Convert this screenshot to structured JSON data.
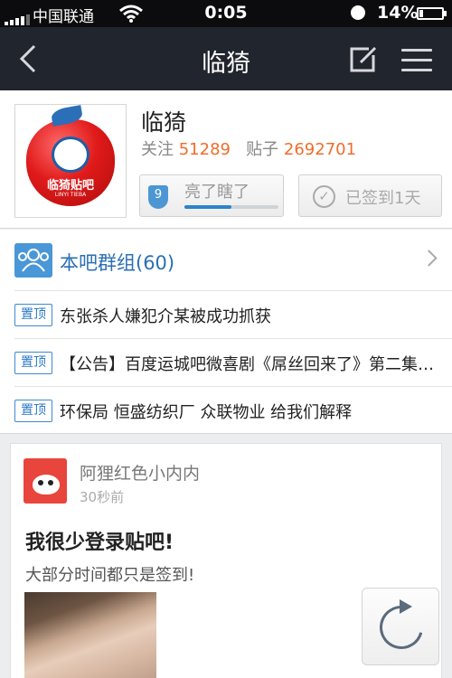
{
  "status_bar": {
    "carrier": "中国联通",
    "time": "0:05",
    "battery": "14%"
  },
  "nav": {
    "title": "临猗"
  },
  "forum": {
    "name": "临猗",
    "follow_label": "关注",
    "follow_count": "51289",
    "posts_label": "贴子",
    "posts_count": "2692701",
    "logo_text": "临猗贴吧",
    "logo_sub": "LINYI TIEBA",
    "level": "9",
    "level_name": "亮了瞎了",
    "level_progress": 0.5,
    "sign_label": "已签到1天"
  },
  "group": {
    "label": "本吧群组(60)"
  },
  "pinned": {
    "tag": "置顶",
    "items": [
      "东张杀人嫌犯介某被成功抓获",
      "【公告】百度运城吧微喜剧《屌丝回来了》第二集…",
      "环保局 恒盛纺织厂 众联物业 给我们解释"
    ]
  },
  "post": {
    "author": "阿狸红色小内内",
    "time": "30秒前",
    "title": "我很少登录贴吧!",
    "body": "大部分时间都只是签到!"
  },
  "colors": {
    "accent": "#f06c2b",
    "link": "#2a6fb3",
    "nav_bg": "#21252d"
  }
}
